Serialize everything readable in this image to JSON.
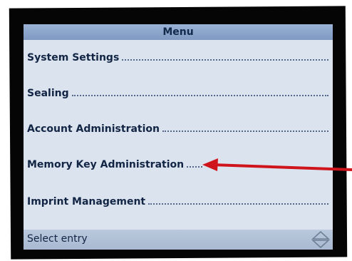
{
  "screen": {
    "title": "Menu",
    "items": [
      {
        "label": "System Settings"
      },
      {
        "label": "Sealing"
      },
      {
        "label": "Account Administration"
      },
      {
        "label": "Memory Key Administration"
      },
      {
        "label": "Imprint Management"
      }
    ],
    "footer": {
      "status": "Select entry",
      "scroll_icon": "up-down-arrows-icon"
    }
  },
  "annotation": {
    "color": "#d0141c",
    "target": "Memory Key Administration"
  },
  "colors": {
    "screen_background": "#dbe3ee",
    "title_bar": "#8ba4cb",
    "text": "#122544",
    "bezel": "#050505"
  }
}
